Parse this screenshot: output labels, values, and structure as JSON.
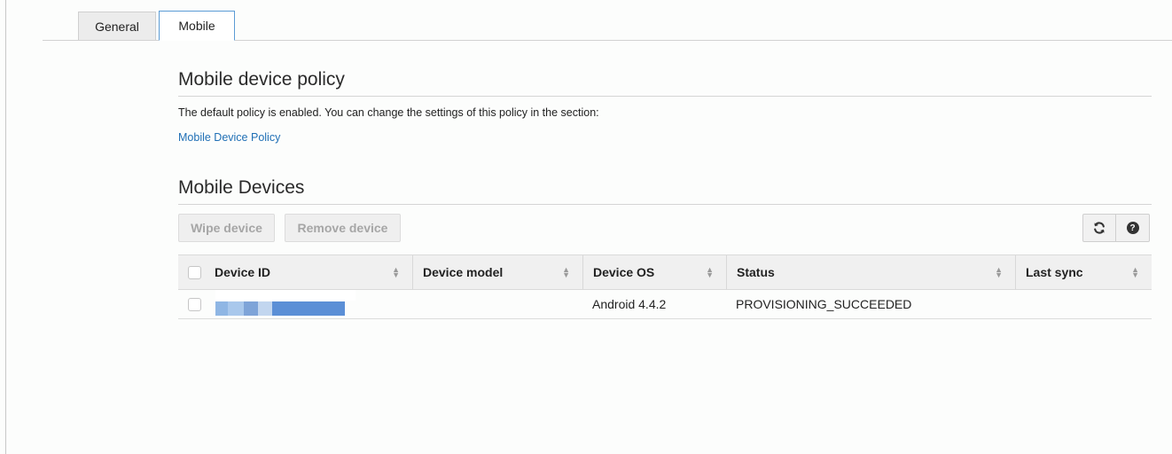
{
  "tabs": [
    {
      "label": "General",
      "active": false
    },
    {
      "label": "Mobile",
      "active": true
    }
  ],
  "policy": {
    "heading": "Mobile device policy",
    "description": "The default policy is enabled. You can change the settings of this policy in the section:",
    "link_label": "Mobile Device Policy"
  },
  "devices": {
    "heading": "Mobile Devices",
    "wipe_label": "Wipe device",
    "remove_label": "Remove device",
    "refresh_icon": "refresh-icon",
    "help_icon": "help-icon",
    "help_glyph": "?"
  },
  "table": {
    "columns": [
      "Device ID",
      "Device model",
      "Device OS",
      "Status",
      "Last sync"
    ],
    "rows": [
      {
        "device_id": "",
        "device_model": "",
        "device_os": "Android 4.4.2",
        "status": "PROVISIONING_SUCCEEDED",
        "last_sync": ""
      }
    ]
  },
  "colors": {
    "link": "#1f6fb5",
    "active_tab_border": "#5b9bd5",
    "redaction": "#5b8fd6"
  }
}
